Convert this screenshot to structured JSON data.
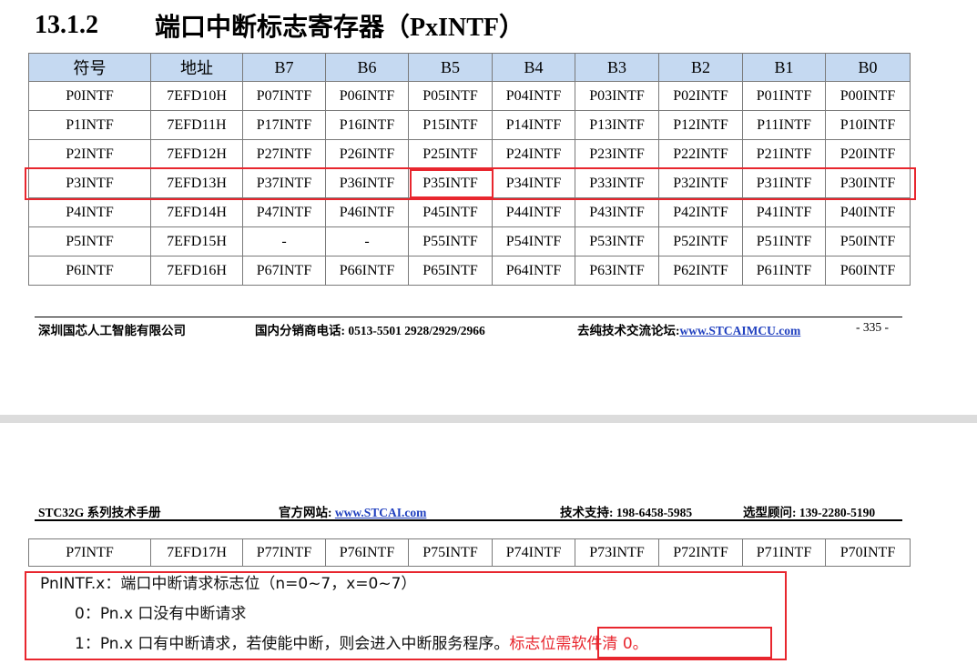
{
  "section": {
    "number": "13.1.2",
    "title": "端口中断标志寄存器（PxINTF）"
  },
  "table1": {
    "headers": [
      "符号",
      "地址",
      "B7",
      "B6",
      "B5",
      "B4",
      "B3",
      "B2",
      "B1",
      "B0"
    ],
    "rows": [
      [
        "P0INTF",
        "7EFD10H",
        "P07INTF",
        "P06INTF",
        "P05INTF",
        "P04INTF",
        "P03INTF",
        "P02INTF",
        "P01INTF",
        "P00INTF"
      ],
      [
        "P1INTF",
        "7EFD11H",
        "P17INTF",
        "P16INTF",
        "P15INTF",
        "P14INTF",
        "P13INTF",
        "P12INTF",
        "P11INTF",
        "P10INTF"
      ],
      [
        "P2INTF",
        "7EFD12H",
        "P27INTF",
        "P26INTF",
        "P25INTF",
        "P24INTF",
        "P23INTF",
        "P22INTF",
        "P21INTF",
        "P20INTF"
      ],
      [
        "P3INTF",
        "7EFD13H",
        "P37INTF",
        "P36INTF",
        "P35INTF",
        "P34INTF",
        "P33INTF",
        "P32INTF",
        "P31INTF",
        "P30INTF"
      ],
      [
        "P4INTF",
        "7EFD14H",
        "P47INTF",
        "P46INTF",
        "P45INTF",
        "P44INTF",
        "P43INTF",
        "P42INTF",
        "P41INTF",
        "P40INTF"
      ],
      [
        "P5INTF",
        "7EFD15H",
        "-",
        "-",
        "P55INTF",
        "P54INTF",
        "P53INTF",
        "P52INTF",
        "P51INTF",
        "P50INTF"
      ],
      [
        "P6INTF",
        "7EFD16H",
        "P67INTF",
        "P66INTF",
        "P65INTF",
        "P64INTF",
        "P63INTF",
        "P62INTF",
        "P61INTF",
        "P60INTF"
      ]
    ]
  },
  "footer": {
    "company": "深圳国芯人工智能有限公司",
    "phone_label": "国内分销商电话: 0513-5501 2928/2929/2966",
    "forum_label": "去纯技术交流论坛:",
    "forum_url": "www.STCAIMCU.com",
    "page": "- 335 -"
  },
  "header2": {
    "manual": "STC32G 系列技术手册",
    "site_label": "官方网站: ",
    "site_url": "www.STCAI.com",
    "support": "技术支持: 198-6458-5985",
    "advisor": "选型顾问: 139-2280-5190"
  },
  "table2": {
    "rows": [
      [
        "P7INTF",
        "7EFD17H",
        "P77INTF",
        "P76INTF",
        "P75INTF",
        "P74INTF",
        "P73INTF",
        "P72INTF",
        "P71INTF",
        "P70INTF"
      ]
    ]
  },
  "description": {
    "line1": "PnINTF.x：端口中断请求标志位（n=0~7，x=0~7）",
    "line2": "0：Pn.x 口没有中断请求",
    "line3_main": "1：Pn.x 口有中断请求，若使能中断，则会进入中断服务程序。",
    "line3_note": "标志位需软件清 0。"
  },
  "colors": {
    "header_fill": "#c5d9f1",
    "highlight": "#e8262e",
    "link": "#1f3fbf"
  }
}
